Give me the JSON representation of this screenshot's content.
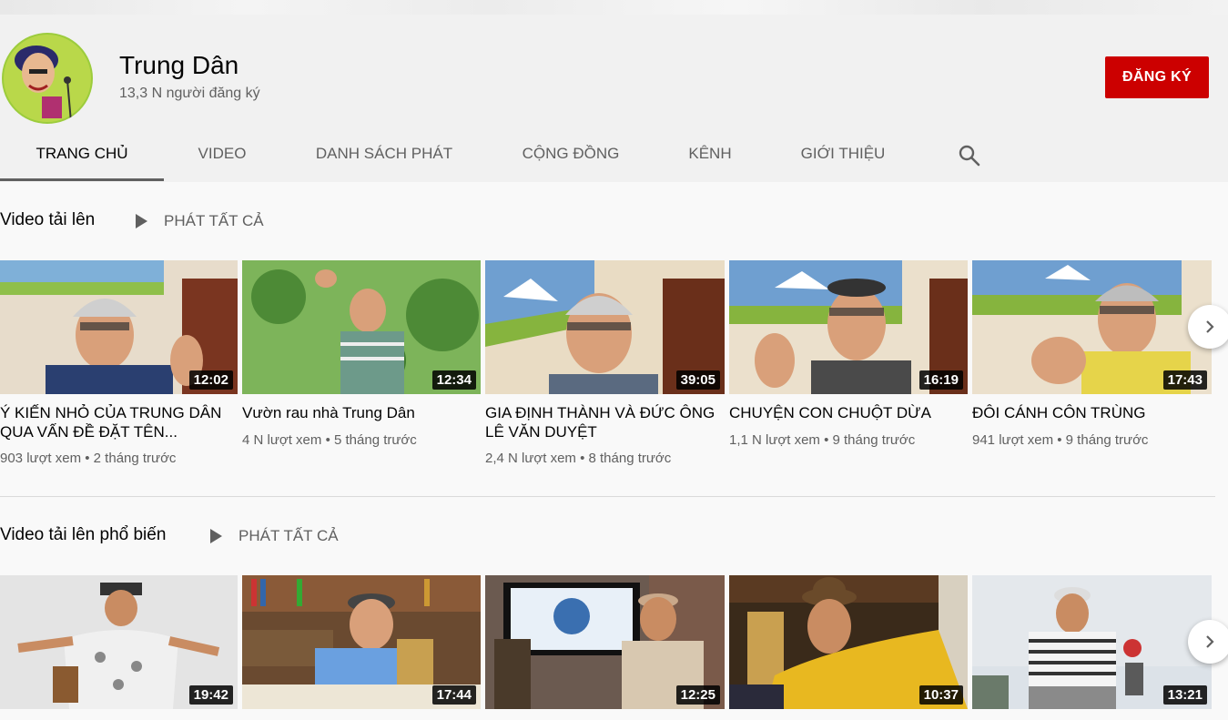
{
  "channel": {
    "name": "Trung Dân",
    "subscribers": "13,3 N người đăng ký",
    "subscribe_label": "ĐĂNG KÝ"
  },
  "tabs": [
    {
      "label": "TRANG CHỦ",
      "active": true
    },
    {
      "label": "VIDEO"
    },
    {
      "label": "DANH SÁCH PHÁT"
    },
    {
      "label": "CỘNG ĐỒNG"
    },
    {
      "label": "KÊNH"
    },
    {
      "label": "GIỚI THIỆU"
    }
  ],
  "sections": [
    {
      "title": "Video tải lên",
      "play_all": "PHÁT TẤT CẢ",
      "videos": [
        {
          "title": "Ý KIẾN NHỎ CỦA TRUNG DÂN QUA VẤN ĐỀ ĐẶT TÊN...",
          "views": "903 lượt xem",
          "age": "2 tháng trước",
          "duration": "12:02"
        },
        {
          "title": "Vườn rau nhà Trung Dân",
          "views": "4 N lượt xem",
          "age": "5 tháng trước",
          "duration": "12:34"
        },
        {
          "title": "GIA ĐỊNH THÀNH VÀ ĐỨC ÔNG LÊ VĂN DUYỆT",
          "views": "2,4 N lượt xem",
          "age": "8 tháng trước",
          "duration": "39:05"
        },
        {
          "title": "CHUYỆN CON CHUỘT DỪA",
          "views": "1,1 N lượt xem",
          "age": "9 tháng trước",
          "duration": "16:19"
        },
        {
          "title": "ĐÔI CÁNH CÔN TRÙNG",
          "views": "941 lượt xem",
          "age": "9 tháng trước",
          "duration": "17:43"
        }
      ]
    },
    {
      "title": "Video tải lên phổ biến",
      "play_all": "PHÁT TẤT CẢ",
      "videos": [
        {
          "duration": "19:42"
        },
        {
          "duration": "17:44"
        },
        {
          "duration": "12:25"
        },
        {
          "duration": "10:37"
        },
        {
          "duration": "13:21"
        }
      ]
    }
  ],
  "colors": {
    "brand_red": "#cc0000",
    "text_secondary": "#606060"
  }
}
